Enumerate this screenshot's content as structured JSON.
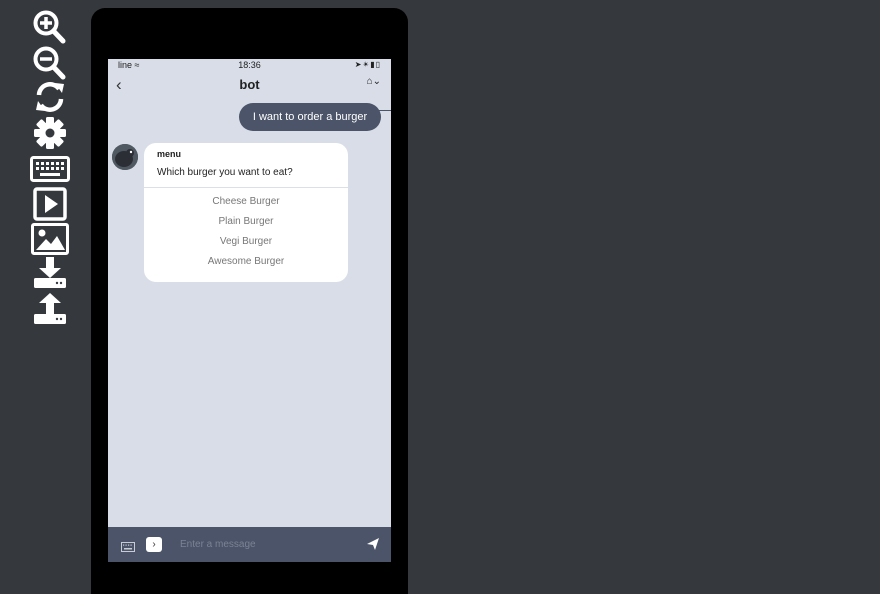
{
  "toolbar": {
    "items": [
      {
        "icon": "zoom-in-icon"
      },
      {
        "icon": "zoom-out-icon"
      },
      {
        "icon": "refresh-icon"
      },
      {
        "icon": "gear-icon"
      },
      {
        "icon": "keyboard-icon"
      },
      {
        "icon": "play-icon"
      },
      {
        "icon": "image-icon"
      },
      {
        "icon": "download-icon"
      },
      {
        "icon": "upload-icon"
      }
    ]
  },
  "status_bar": {
    "carrier": "line",
    "time": "18:36"
  },
  "chat": {
    "title": "bot",
    "back_icon": "chevron-left-icon",
    "nav_icons": [
      "home-icon",
      "chevron-down-icon"
    ],
    "user_message": "I want to order a burger",
    "bot_card": {
      "title": "menu",
      "text": "Which burger you want to eat?",
      "options": [
        "Cheese Burger",
        "Plain Burger",
        "Vegi Burger",
        "Awesome Burger"
      ]
    },
    "input": {
      "placeholder": "Enter a message",
      "value": ""
    }
  },
  "colors": {
    "background": "#35393d",
    "screen": "#d8dde7",
    "bubble": "#4b5468",
    "icon": "#ffffff"
  }
}
